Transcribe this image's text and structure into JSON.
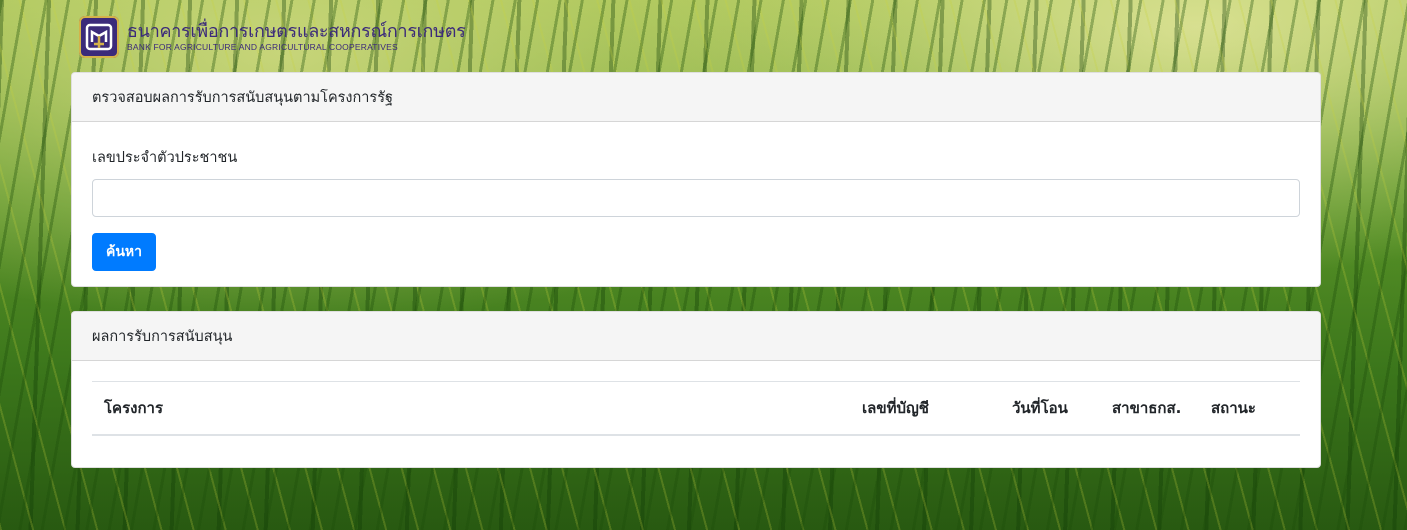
{
  "header": {
    "logo_icon": "baac-logo",
    "brand_th": "ธนาคารเพื่อการเกษตรและสหกรณ์การเกษตร",
    "brand_en": "BANK FOR AGRICULTURE AND AGRICULTURAL COOPERATIVES"
  },
  "search_card": {
    "title": "ตรวจสอบผลการรับการสนับสนุนตามโครงการรัฐ",
    "field_label": "เลขประจำตัวประชาชน",
    "field_value": "",
    "field_placeholder": "",
    "button_label": "ค้นหา"
  },
  "result_card": {
    "title": "ผลการรับการสนับสนุน",
    "columns": [
      "โครงการ",
      "เลขที่บัญชี",
      "วันที่โอน",
      "สาขาธกส.",
      "สถานะ"
    ],
    "rows": []
  },
  "colors": {
    "primary": "#007bff",
    "brand": "#3b2a7a",
    "card_header_bg": "#f5f5f5"
  }
}
